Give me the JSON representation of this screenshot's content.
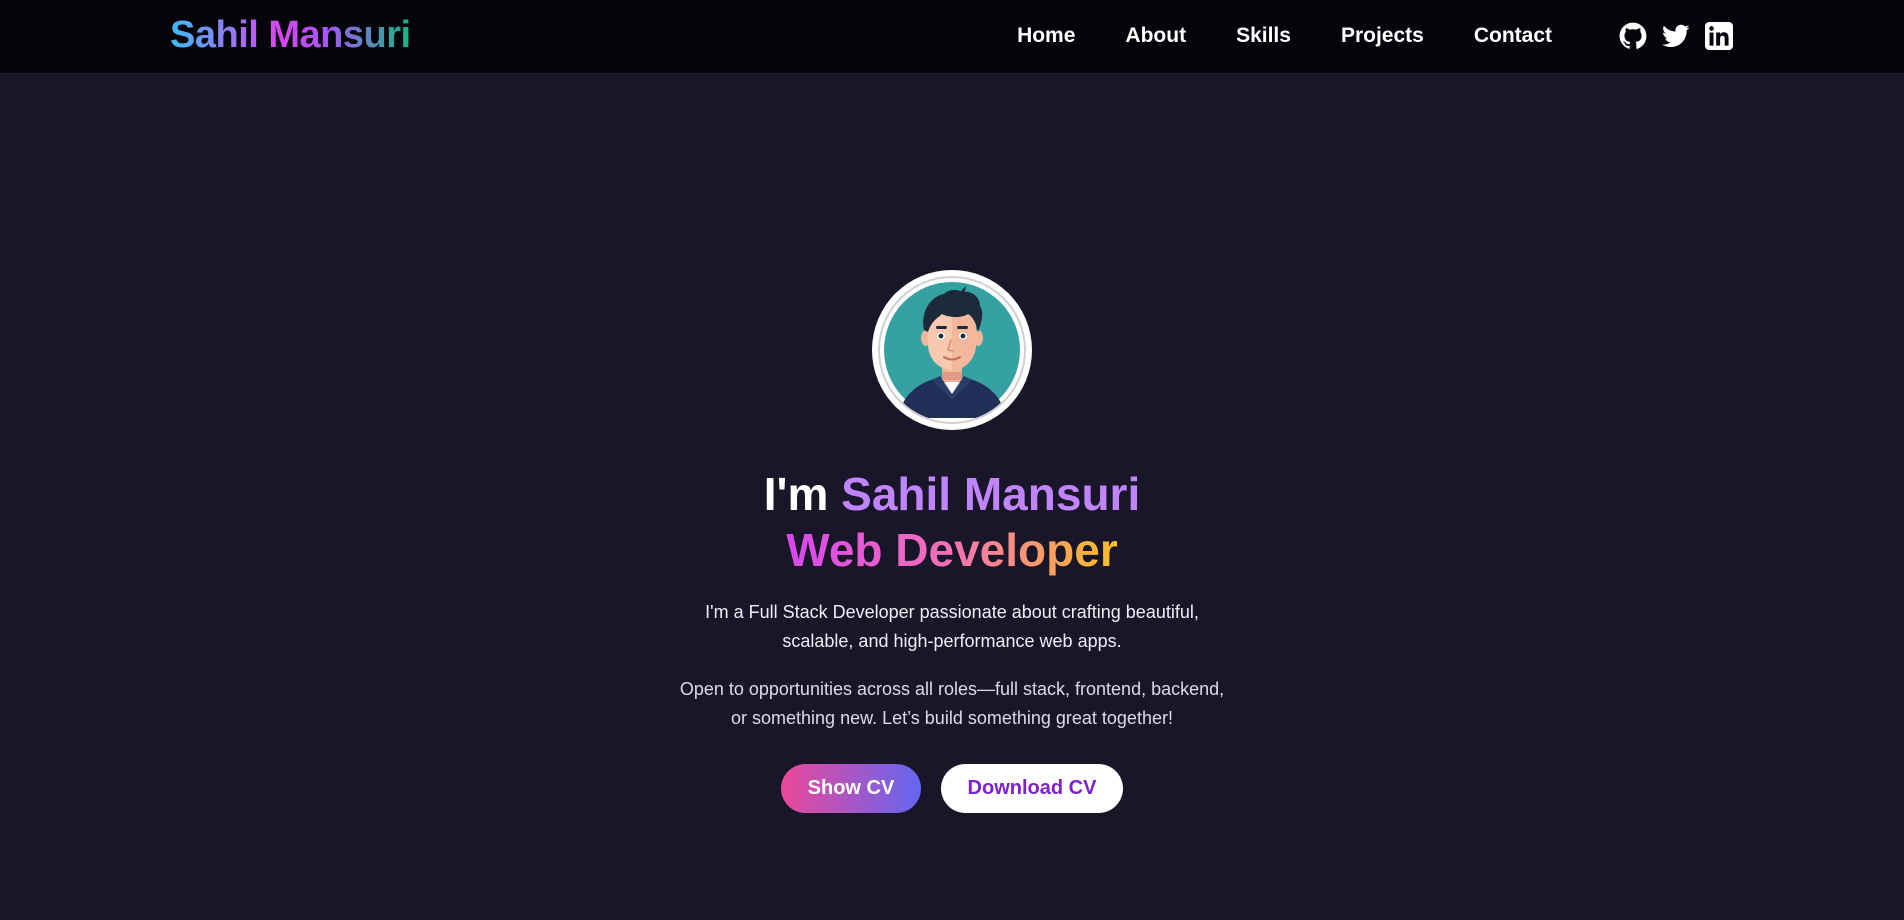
{
  "brand": {
    "name": "Sahil Mansuri"
  },
  "nav": {
    "items": [
      {
        "label": "Home"
      },
      {
        "label": "About"
      },
      {
        "label": "Skills"
      },
      {
        "label": "Projects"
      },
      {
        "label": "Contact"
      }
    ],
    "social": [
      {
        "icon": "github-icon"
      },
      {
        "icon": "twitter-icon"
      },
      {
        "icon": "linkedin-icon"
      }
    ]
  },
  "hero": {
    "greeting": "I'm",
    "name": "Sahil Mansuri",
    "role": "Web Developer",
    "intro": "I'm a Full Stack Developer passionate about crafting beautiful, scalable, and high-performance web apps.",
    "availability": "Open to opportunities across all roles—full stack, frontend, backend, or something new. Let’s build something great together!",
    "primary_button": "Show CV",
    "secondary_button": "Download CV"
  },
  "colors": {
    "background": "#181628",
    "navbar": "#04040a",
    "name_accent": "#c084fc",
    "primary_gradient_start": "#ec4899",
    "primary_gradient_end": "#6366f1",
    "secondary_text": "#7e22ce"
  }
}
